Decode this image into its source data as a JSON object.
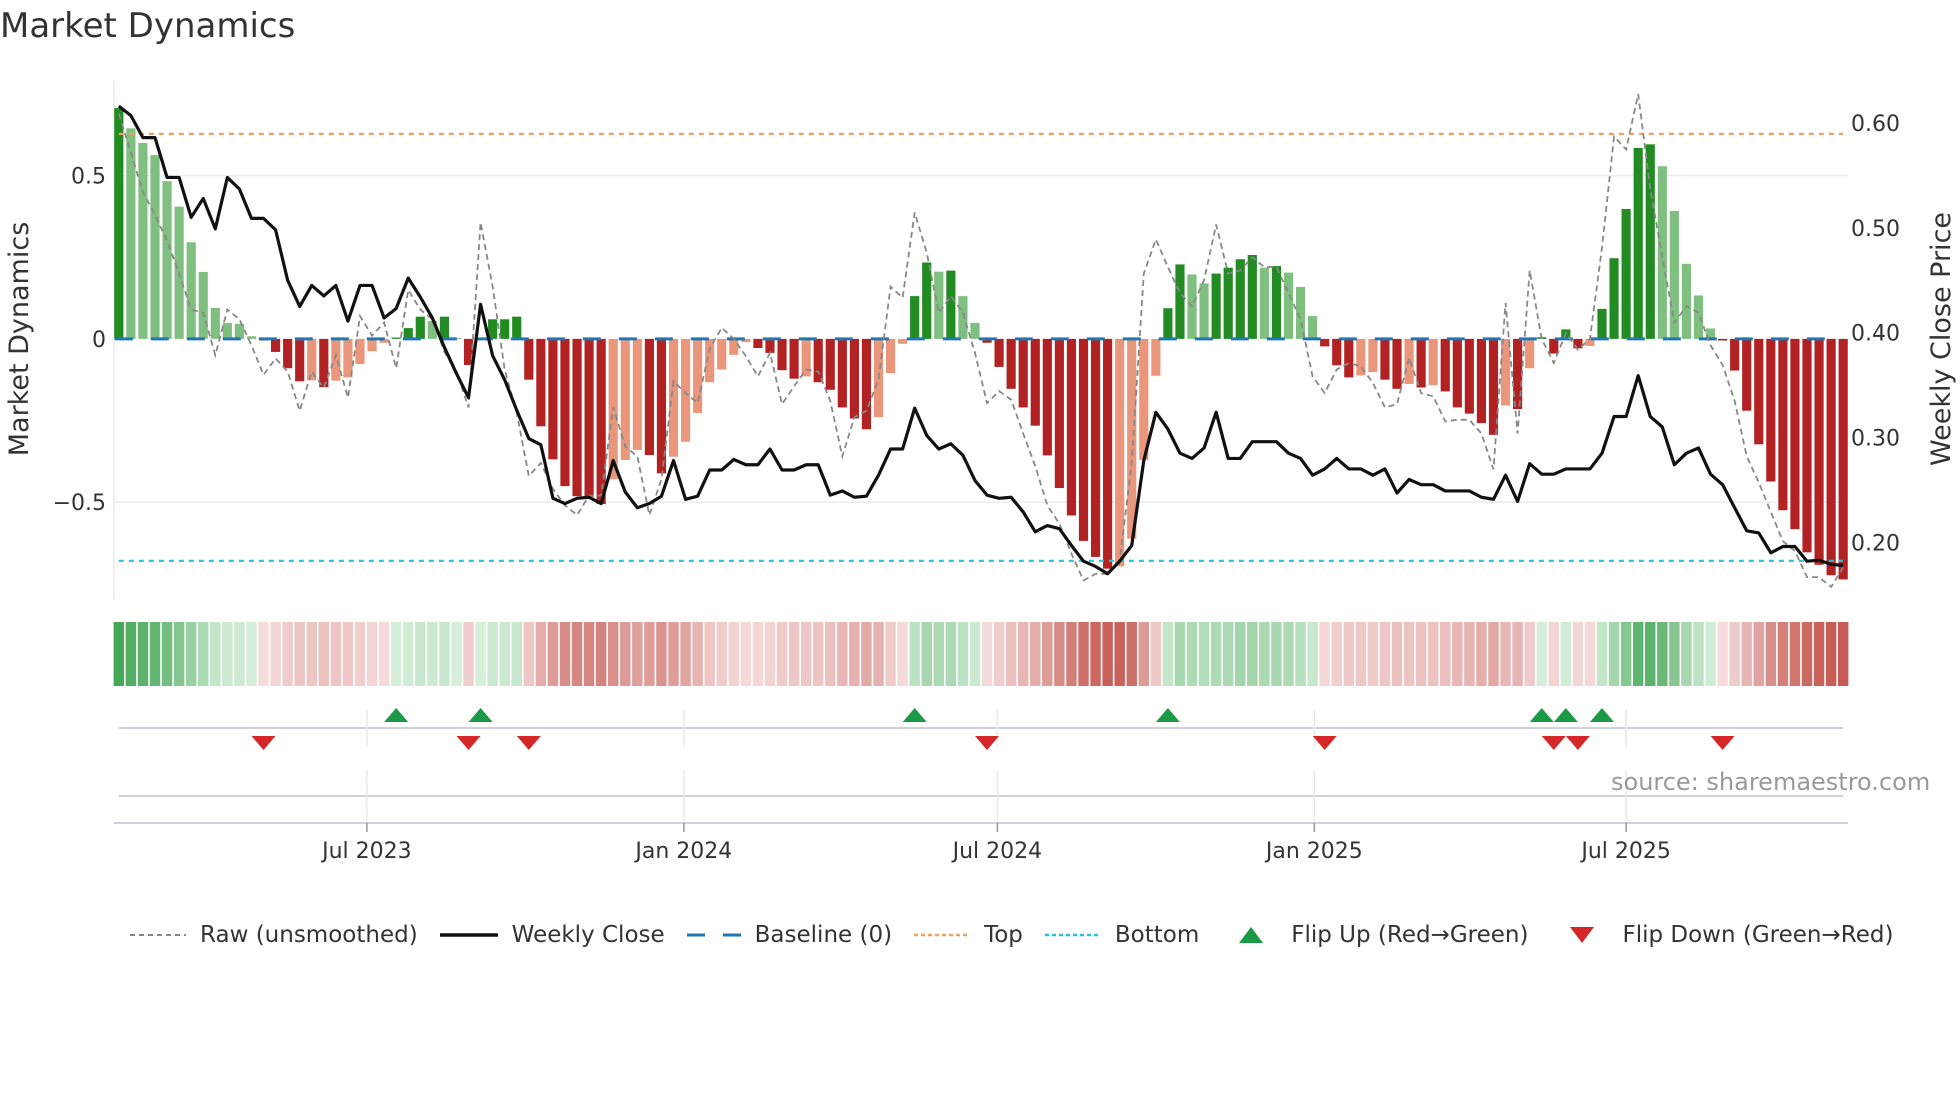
{
  "title": "Market Dynamics",
  "source_note": "source: sharemaestro.com",
  "colors": {
    "pos_strong": "#228b22",
    "pos_weak": "#7fbf7f",
    "neg_strong": "#b22222",
    "neg_weak": "#e9967a",
    "raw": "#888888",
    "close": "#111111",
    "baseline": "#1f77b4",
    "top": "#f0a060",
    "bottom": "#22c4d8",
    "flip_up": "#1a9a45",
    "flip_down": "#d62728"
  },
  "chart_data": {
    "type": "bar",
    "title": "Market Dynamics",
    "xlabel": "",
    "ylabel": "Market Dynamics",
    "ylabel_right": "Weekly Close Price",
    "x_start": "2023-02-07",
    "x_frequency": "weekly",
    "ylim": [
      -0.8,
      0.79
    ],
    "ylim_right": [
      0.145,
      0.64
    ],
    "yticks": [
      {
        "value": 0.5,
        "label": "0.5"
      },
      {
        "value": 0,
        "label": "0"
      },
      {
        "value": -0.5,
        "label": "−0.5"
      }
    ],
    "yticks_right": [
      {
        "value": 0.6,
        "label": "0.60"
      },
      {
        "value": 0.5,
        "label": "0.50"
      },
      {
        "value": 0.4,
        "label": "0.40"
      },
      {
        "value": 0.3,
        "label": "0.30"
      },
      {
        "value": 0.2,
        "label": "0.20"
      }
    ],
    "xticks": [
      {
        "date": "2023-07-01",
        "label": "Jul 2023"
      },
      {
        "date": "2024-01-01",
        "label": "Jan 2024"
      },
      {
        "date": "2024-07-01",
        "label": "Jul 2024"
      },
      {
        "date": "2025-01-01",
        "label": "Jan 2025"
      },
      {
        "date": "2025-07-01",
        "label": "Jul 2025"
      }
    ],
    "grid": true,
    "top_threshold": 0.628,
    "bottom_threshold": -0.68,
    "baseline": 0,
    "legend_position": "bottom",
    "series": [
      {
        "name": "Market Dynamics (smoothed)",
        "type": "bar",
        "values": [
          0.707,
          0.645,
          0.6,
          0.563,
          0.483,
          0.405,
          0.296,
          0.205,
          0.095,
          0.049,
          0.046,
          0.008,
          -0.005,
          -0.04,
          -0.09,
          -0.13,
          -0.127,
          -0.148,
          -0.128,
          -0.118,
          -0.077,
          -0.038,
          -0.012,
          0.004,
          0.033,
          0.068,
          0.055,
          0.068,
          0.003,
          -0.08,
          0.003,
          0.06,
          0.06,
          0.068,
          -0.125,
          -0.268,
          -0.369,
          -0.451,
          -0.482,
          -0.484,
          -0.506,
          -0.43,
          -0.371,
          -0.34,
          -0.356,
          -0.412,
          -0.361,
          -0.315,
          -0.227,
          -0.133,
          -0.094,
          -0.049,
          -0.01,
          -0.028,
          -0.043,
          -0.096,
          -0.122,
          -0.115,
          -0.133,
          -0.156,
          -0.21,
          -0.244,
          -0.277,
          -0.24,
          -0.105,
          -0.015,
          0.131,
          0.234,
          0.206,
          0.209,
          0.131,
          0.049,
          -0.012,
          -0.086,
          -0.153,
          -0.21,
          -0.266,
          -0.357,
          -0.457,
          -0.541,
          -0.619,
          -0.668,
          -0.704,
          -0.697,
          -0.612,
          -0.371,
          -0.113,
          0.094,
          0.228,
          0.197,
          0.17,
          0.2,
          0.218,
          0.244,
          0.257,
          0.218,
          0.223,
          0.203,
          0.159,
          0.07,
          -0.023,
          -0.081,
          -0.118,
          -0.112,
          -0.102,
          -0.125,
          -0.153,
          -0.138,
          -0.149,
          -0.142,
          -0.161,
          -0.21,
          -0.229,
          -0.258,
          -0.294,
          -0.204,
          -0.215,
          -0.09,
          0.005,
          -0.045,
          0.029,
          -0.029,
          -0.022,
          0.092,
          0.247,
          0.398,
          0.585,
          0.596,
          0.529,
          0.392,
          0.23,
          0.133,
          0.032,
          -0.005,
          -0.097,
          -0.22,
          -0.323,
          -0.437,
          -0.525,
          -0.583,
          -0.654,
          -0.692,
          -0.724,
          -0.737
        ]
      },
      {
        "name": "Raw (unsmoothed)",
        "type": "line",
        "values": [
          0.69,
          0.57,
          0.45,
          0.38,
          0.3,
          0.2,
          0.09,
          0.08,
          -0.05,
          0.09,
          0.06,
          -0.02,
          -0.11,
          -0.06,
          -0.1,
          -0.22,
          -0.1,
          -0.15,
          -0.05,
          -0.18,
          0.07,
          0.01,
          0.05,
          -0.09,
          0.15,
          0.09,
          0.06,
          -0.04,
          -0.1,
          -0.21,
          0.357,
          0.16,
          -0.094,
          -0.227,
          -0.42,
          -0.38,
          -0.46,
          -0.51,
          -0.54,
          -0.48,
          -0.48,
          -0.21,
          -0.33,
          -0.36,
          -0.54,
          -0.43,
          -0.13,
          -0.166,
          -0.197,
          -0.03,
          0.034,
          0.0,
          -0.053,
          -0.115,
          -0.043,
          -0.2,
          -0.145,
          -0.094,
          -0.1,
          -0.19,
          -0.36,
          -0.24,
          -0.22,
          -0.125,
          0.16,
          0.126,
          0.387,
          0.264,
          0.08,
          0.131,
          0.08,
          -0.043,
          -0.197,
          -0.16,
          -0.186,
          -0.29,
          -0.39,
          -0.51,
          -0.566,
          -0.658,
          -0.74,
          -0.72,
          -0.72,
          -0.68,
          -0.38,
          0.2,
          0.305,
          0.22,
          0.14,
          0.1,
          0.18,
          0.35,
          0.2,
          0.21,
          0.25,
          0.22,
          0.22,
          0.14,
          0.06,
          -0.115,
          -0.166,
          -0.094,
          -0.074,
          -0.084,
          -0.135,
          -0.21,
          -0.2,
          -0.058,
          -0.166,
          -0.176,
          -0.253,
          -0.248,
          -0.248,
          -0.29,
          -0.4,
          0.11,
          -0.29,
          0.21,
          0.0,
          -0.074,
          0.018,
          -0.033,
          0.0,
          0.28,
          0.62,
          0.58,
          0.75,
          0.46,
          0.25,
          0.05,
          0.1,
          0.08,
          -0.02,
          -0.08,
          -0.19,
          -0.36,
          -0.44,
          -0.53,
          -0.62,
          -0.65,
          -0.73,
          -0.73,
          -0.76,
          -0.7
        ]
      },
      {
        "name": "Weekly Close",
        "type": "line",
        "axis": "right",
        "values": [
          0.616,
          0.607,
          0.586,
          0.586,
          0.548,
          0.548,
          0.51,
          0.528,
          0.499,
          0.548,
          0.537,
          0.509,
          0.509,
          0.498,
          0.45,
          0.425,
          0.445,
          0.435,
          0.445,
          0.411,
          0.445,
          0.445,
          0.414,
          0.423,
          0.452,
          0.434,
          0.414,
          0.386,
          0.361,
          0.338,
          0.427,
          0.378,
          0.355,
          0.326,
          0.299,
          0.293,
          0.242,
          0.237,
          0.242,
          0.243,
          0.237,
          0.278,
          0.248,
          0.233,
          0.237,
          0.244,
          0.278,
          0.241,
          0.244,
          0.269,
          0.269,
          0.279,
          0.274,
          0.274,
          0.289,
          0.269,
          0.269,
          0.274,
          0.274,
          0.245,
          0.249,
          0.243,
          0.244,
          0.264,
          0.289,
          0.289,
          0.328,
          0.302,
          0.289,
          0.294,
          0.283,
          0.259,
          0.245,
          0.242,
          0.243,
          0.229,
          0.21,
          0.216,
          0.213,
          0.197,
          0.182,
          0.177,
          0.17,
          0.182,
          0.197,
          0.278,
          0.324,
          0.308,
          0.285,
          0.28,
          0.29,
          0.324,
          0.28,
          0.28,
          0.296,
          0.296,
          0.296,
          0.285,
          0.28,
          0.264,
          0.27,
          0.28,
          0.27,
          0.27,
          0.264,
          0.27,
          0.247,
          0.26,
          0.255,
          0.255,
          0.249,
          0.249,
          0.249,
          0.243,
          0.241,
          0.264,
          0.239,
          0.275,
          0.265,
          0.265,
          0.27,
          0.27,
          0.27,
          0.285,
          0.32,
          0.32,
          0.359,
          0.32,
          0.31,
          0.274,
          0.285,
          0.29,
          0.265,
          0.255,
          0.233,
          0.211,
          0.209,
          0.19,
          0.196,
          0.196,
          0.182,
          0.183,
          0.179,
          0.178
        ]
      }
    ],
    "flip_up_weeks": [
      23,
      30,
      66,
      87,
      118,
      120,
      123
    ],
    "flip_down_weeks": [
      12,
      29,
      34,
      72,
      100,
      119,
      121,
      133
    ]
  },
  "legend": {
    "raw": "Raw (unsmoothed)",
    "close": "Weekly Close",
    "baseline": "Baseline (0)",
    "top": "Top",
    "bottom": "Bottom",
    "flip_up": "Flip Up (Red→Green)",
    "flip_down": "Flip Down (Green→Red)"
  }
}
